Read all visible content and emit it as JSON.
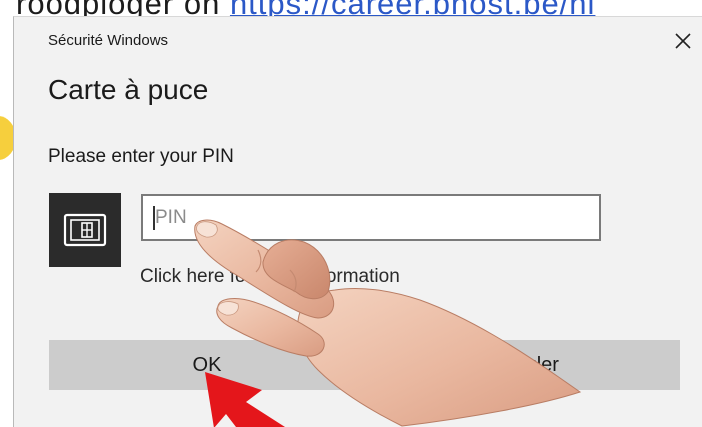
{
  "background": {
    "text_prefix": "roodploger on ",
    "link_text": "https://career.bnost.be/nl",
    "accent_colors": {
      "link": "#2b58c7",
      "yellow": "#f6cf3d"
    }
  },
  "dialog": {
    "caption": "Sécurité Windows",
    "title": "Carte à puce",
    "prompt": "Please enter your PIN",
    "pin_placeholder": "PIN",
    "more_info": "Click here for more information",
    "ok_label": "OK",
    "cancel_label": "Annuler",
    "icons": {
      "close": "close-icon",
      "smartcard": "smartcard-icon"
    },
    "colors": {
      "background": "#f2f2f2",
      "button": "#cccccc",
      "tile": "#2b2b2b"
    }
  },
  "overlays": {
    "hand": "pointing-hand-image",
    "arrow": "red-arrow-annotation",
    "arrow_color": "#e4161b"
  }
}
